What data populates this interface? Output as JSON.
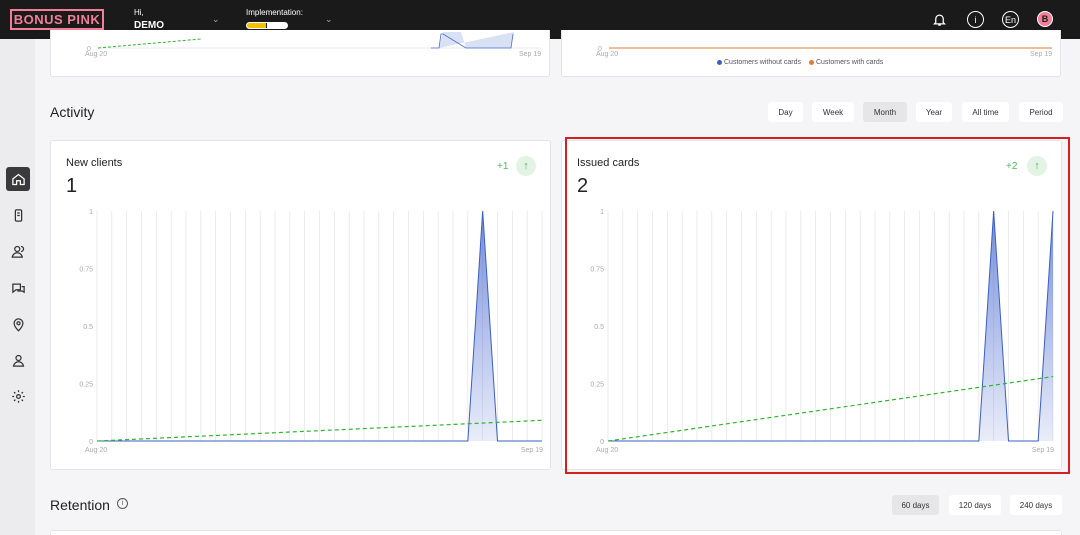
{
  "brand": {
    "logo_text": "BONUS PINK"
  },
  "header": {
    "greeting": "Hi,",
    "user": "DEMO",
    "implementation_label": "Implementation:",
    "implementation_progress": 0.5,
    "lang": "En",
    "avatar_letter": "B"
  },
  "sidebar": {
    "items": [
      "home-icon",
      "phone-icon",
      "users-icon",
      "chat-icon",
      "location-icon",
      "person-icon",
      "gear-icon"
    ],
    "active": 0
  },
  "top_cards": {
    "left": {
      "x_start": "Aug 20",
      "x_end": "Sep 19"
    },
    "right": {
      "x_start": "Aug 20",
      "x_end": "Sep 19",
      "legend": [
        {
          "label": "Customers without cards",
          "color": "#3a5fc4"
        },
        {
          "label": "Customers with cards",
          "color": "#e07b39"
        }
      ]
    }
  },
  "activity": {
    "title": "Activity",
    "periods": [
      "Day",
      "Week",
      "Month",
      "Year",
      "All time",
      "Period"
    ],
    "selected_period": "Month"
  },
  "new_clients": {
    "title": "New clients",
    "value": "1",
    "delta": "+1",
    "arrow": "↑",
    "chart_data": {
      "type": "area",
      "y_ticks": [
        "1",
        "0.75",
        "0.5",
        "0.25",
        "0"
      ],
      "ylim": [
        0,
        1
      ],
      "x_start": "Aug 20",
      "x_end": "Sep 19",
      "days": 31,
      "values": [
        0,
        0,
        0,
        0,
        0,
        0,
        0,
        0,
        0,
        0,
        0,
        0,
        0,
        0,
        0,
        0,
        0,
        0,
        0,
        0,
        0,
        0,
        0,
        0,
        0,
        0,
        1,
        0,
        0,
        0,
        0
      ],
      "trend": [
        0,
        0.09
      ],
      "series_color": "#3a5fc4",
      "trend_color": "#2fb52f"
    }
  },
  "issued_cards": {
    "title": "Issued cards",
    "value": "2",
    "delta": "+2",
    "arrow": "↑",
    "chart_data": {
      "type": "area",
      "y_ticks": [
        "1",
        "0.75",
        "0.5",
        "0.25",
        "0"
      ],
      "ylim": [
        0,
        1
      ],
      "x_start": "Aug 20",
      "x_end": "Sep 19",
      "days": 31,
      "values": [
        0,
        0,
        0,
        0,
        0,
        0,
        0,
        0,
        0,
        0,
        0,
        0,
        0,
        0,
        0,
        0,
        0,
        0,
        0,
        0,
        0,
        0,
        0,
        0,
        0,
        0,
        1,
        0,
        0,
        0,
        1
      ],
      "trend": [
        0,
        0.28
      ],
      "series_color": "#3a5fc4",
      "trend_color": "#2fb52f"
    }
  },
  "retention": {
    "title": "Retention",
    "info_icon": "info-icon",
    "options": [
      "60 days",
      "120 days",
      "240 days"
    ],
    "selected": "60 days"
  }
}
